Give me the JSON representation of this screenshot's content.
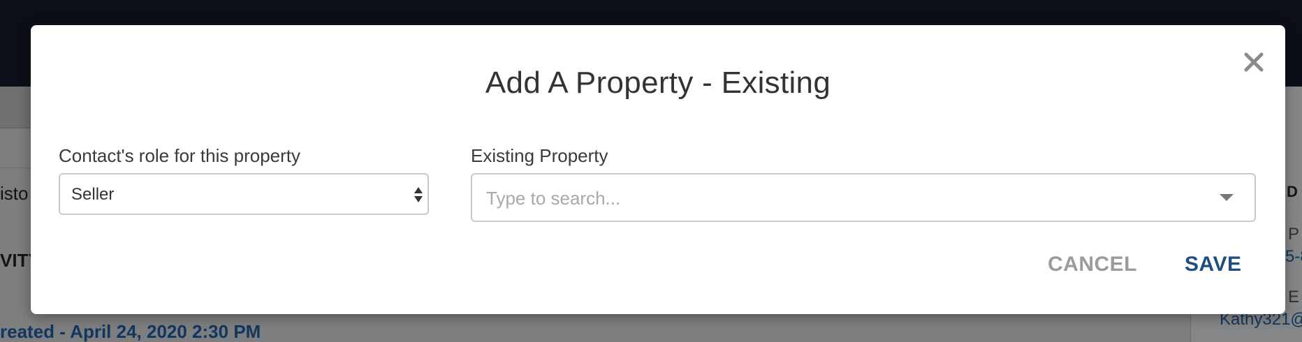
{
  "background": {
    "history_fragment": "isto",
    "activity_fragment": "VITY",
    "created_fragment": "reated - April 24, 2020 2:30 PM",
    "right_panel": {
      "heading_fragment": "D",
      "phone_label_fragment": "P",
      "phone_fragment": "5-8",
      "email_label_fragment": "E",
      "email_fragment": "Kathy321@"
    }
  },
  "modal": {
    "title": "Add A Property - Existing",
    "close_icon": "close-icon",
    "role_field": {
      "label": "Contact's role for this property",
      "value": "Seller"
    },
    "property_field": {
      "label": "Existing Property",
      "value": "",
      "placeholder": "Type to search..."
    },
    "actions": {
      "cancel_label": "CANCEL",
      "save_label": "SAVE"
    }
  },
  "colors": {
    "primary": "#1e4d82",
    "muted_button": "#9b9b9b",
    "title_text": "#333333",
    "overlay_topbar": "#0b0f17"
  }
}
